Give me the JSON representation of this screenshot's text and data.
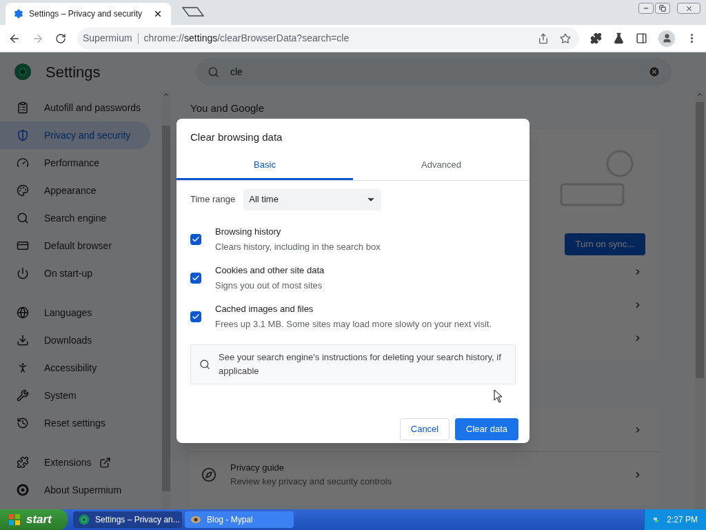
{
  "browser": {
    "tabs": [
      {
        "title": "Settings – Privacy and security",
        "selected": true
      }
    ],
    "nav": {
      "forward_enabled": false
    },
    "address": {
      "origin_label": "Supermium",
      "url_scheme": "chrome://",
      "url_host": "settings",
      "url_path": "/clearBrowserData?search=cle"
    }
  },
  "settings": {
    "title": "Settings",
    "search": {
      "value": "cle"
    },
    "sidebar": [
      {
        "items": [
          {
            "label": "Autofill and passwords",
            "selected": false,
            "kind": "page"
          },
          {
            "label": "Privacy and security",
            "selected": true,
            "kind": "page"
          },
          {
            "label": "Performance",
            "selected": false,
            "kind": "page"
          },
          {
            "label": "Appearance",
            "selected": false,
            "kind": "page"
          },
          {
            "label": "Search engine",
            "selected": false,
            "kind": "page"
          },
          {
            "label": "Default browser",
            "selected": false,
            "kind": "page"
          },
          {
            "label": "On start-up",
            "selected": false,
            "kind": "page"
          }
        ]
      },
      {
        "items": [
          {
            "label": "Languages",
            "selected": false,
            "kind": "page"
          },
          {
            "label": "Downloads",
            "selected": false,
            "kind": "page"
          },
          {
            "label": "Accessibility",
            "selected": false,
            "kind": "page"
          },
          {
            "label": "System",
            "selected": false,
            "kind": "page"
          },
          {
            "label": "Reset settings",
            "selected": false,
            "kind": "page"
          }
        ]
      },
      {
        "items": [
          {
            "label": "Extensions",
            "selected": false,
            "kind": "external"
          },
          {
            "label": "About Supermium",
            "selected": false,
            "kind": "page"
          }
        ]
      }
    ],
    "section_heading": "You and Google",
    "sync_button": "Turn on sync...",
    "privacy_guide": {
      "title": "Privacy guide",
      "description": "Review key privacy and security controls"
    }
  },
  "dialog": {
    "title": "Clear browsing data",
    "tabs": [
      {
        "label": "Basic",
        "selected": true
      },
      {
        "label": "Advanced",
        "selected": false
      }
    ],
    "time_range": {
      "label": "Time range",
      "value": "All time"
    },
    "options": [
      {
        "title": "Browsing history",
        "description": "Clears history, including in the search box",
        "checked": true
      },
      {
        "title": "Cookies and other site data",
        "description": "Signs you out of most sites",
        "checked": true
      },
      {
        "title": "Cached images and files",
        "description": "Frees up 3.1 MB. Some sites may load more slowly on your next visit.",
        "checked": true
      }
    ],
    "info": "See your search engine's instructions for deleting your search history, if applicable",
    "buttons": {
      "cancel": "Cancel",
      "confirm": "Clear data"
    }
  },
  "taskbar": {
    "start": "start",
    "tasks": [
      {
        "title": "Settings – Privacy an...",
        "selected": true
      },
      {
        "title": "Blog - Mypal",
        "selected": false
      }
    ],
    "clock": "2:27 PM"
  }
}
